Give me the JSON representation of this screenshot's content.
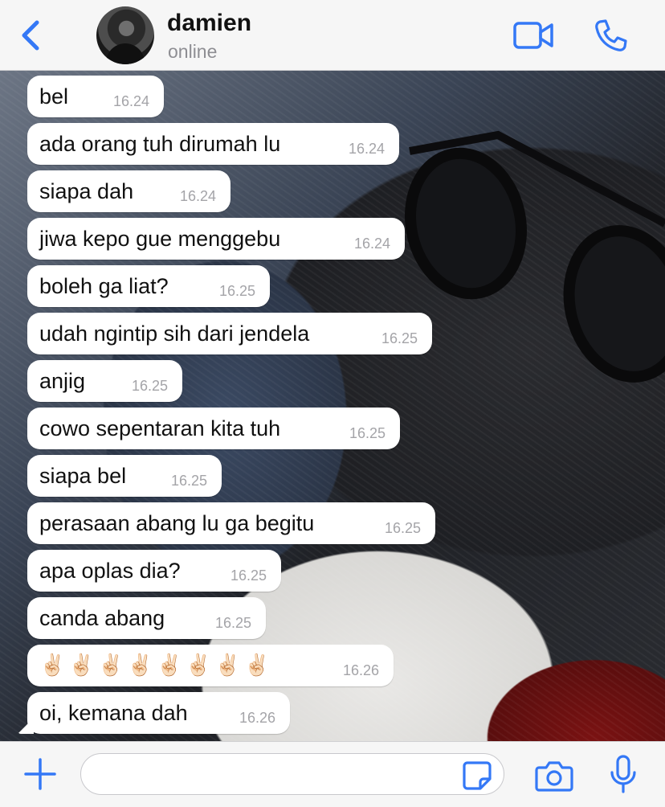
{
  "header": {
    "contact_name": "damien",
    "status": "online",
    "icons": {
      "back": "chevron-left-icon",
      "video": "video-camera-icon",
      "call": "phone-icon"
    },
    "accent_color": "#3478f6"
  },
  "messages": [
    {
      "text": "bel",
      "time": "16.24"
    },
    {
      "text": "ada orang tuh dirumah lu",
      "time": "16.24"
    },
    {
      "text": "siapa dah",
      "time": "16.24"
    },
    {
      "text": "jiwa kepo gue menggebu",
      "time": "16.24"
    },
    {
      "text": "boleh ga liat?",
      "time": "16.25"
    },
    {
      "text": "udah ngintip sih dari jendela",
      "time": "16.25"
    },
    {
      "text": "anjig",
      "time": "16.25"
    },
    {
      "text": "cowo sepentaran kita tuh",
      "time": "16.25"
    },
    {
      "text": "siapa bel",
      "time": "16.25"
    },
    {
      "text": "perasaan abang lu ga begitu",
      "time": "16.25"
    },
    {
      "text": "apa oplas dia?",
      "time": "16.25"
    },
    {
      "text": "canda abang",
      "time": "16.25"
    },
    {
      "text": "✌🏻✌🏻✌🏻✌🏻✌🏻✌🏻✌🏻✌🏻",
      "time": "16.26"
    },
    {
      "text": "oi, kemana dah",
      "time": "16.26"
    }
  ],
  "input_bar": {
    "message_value": "",
    "icons": {
      "plus": "plus-icon",
      "sticker": "sticker-icon",
      "camera": "camera-icon",
      "mic": "microphone-icon"
    }
  }
}
